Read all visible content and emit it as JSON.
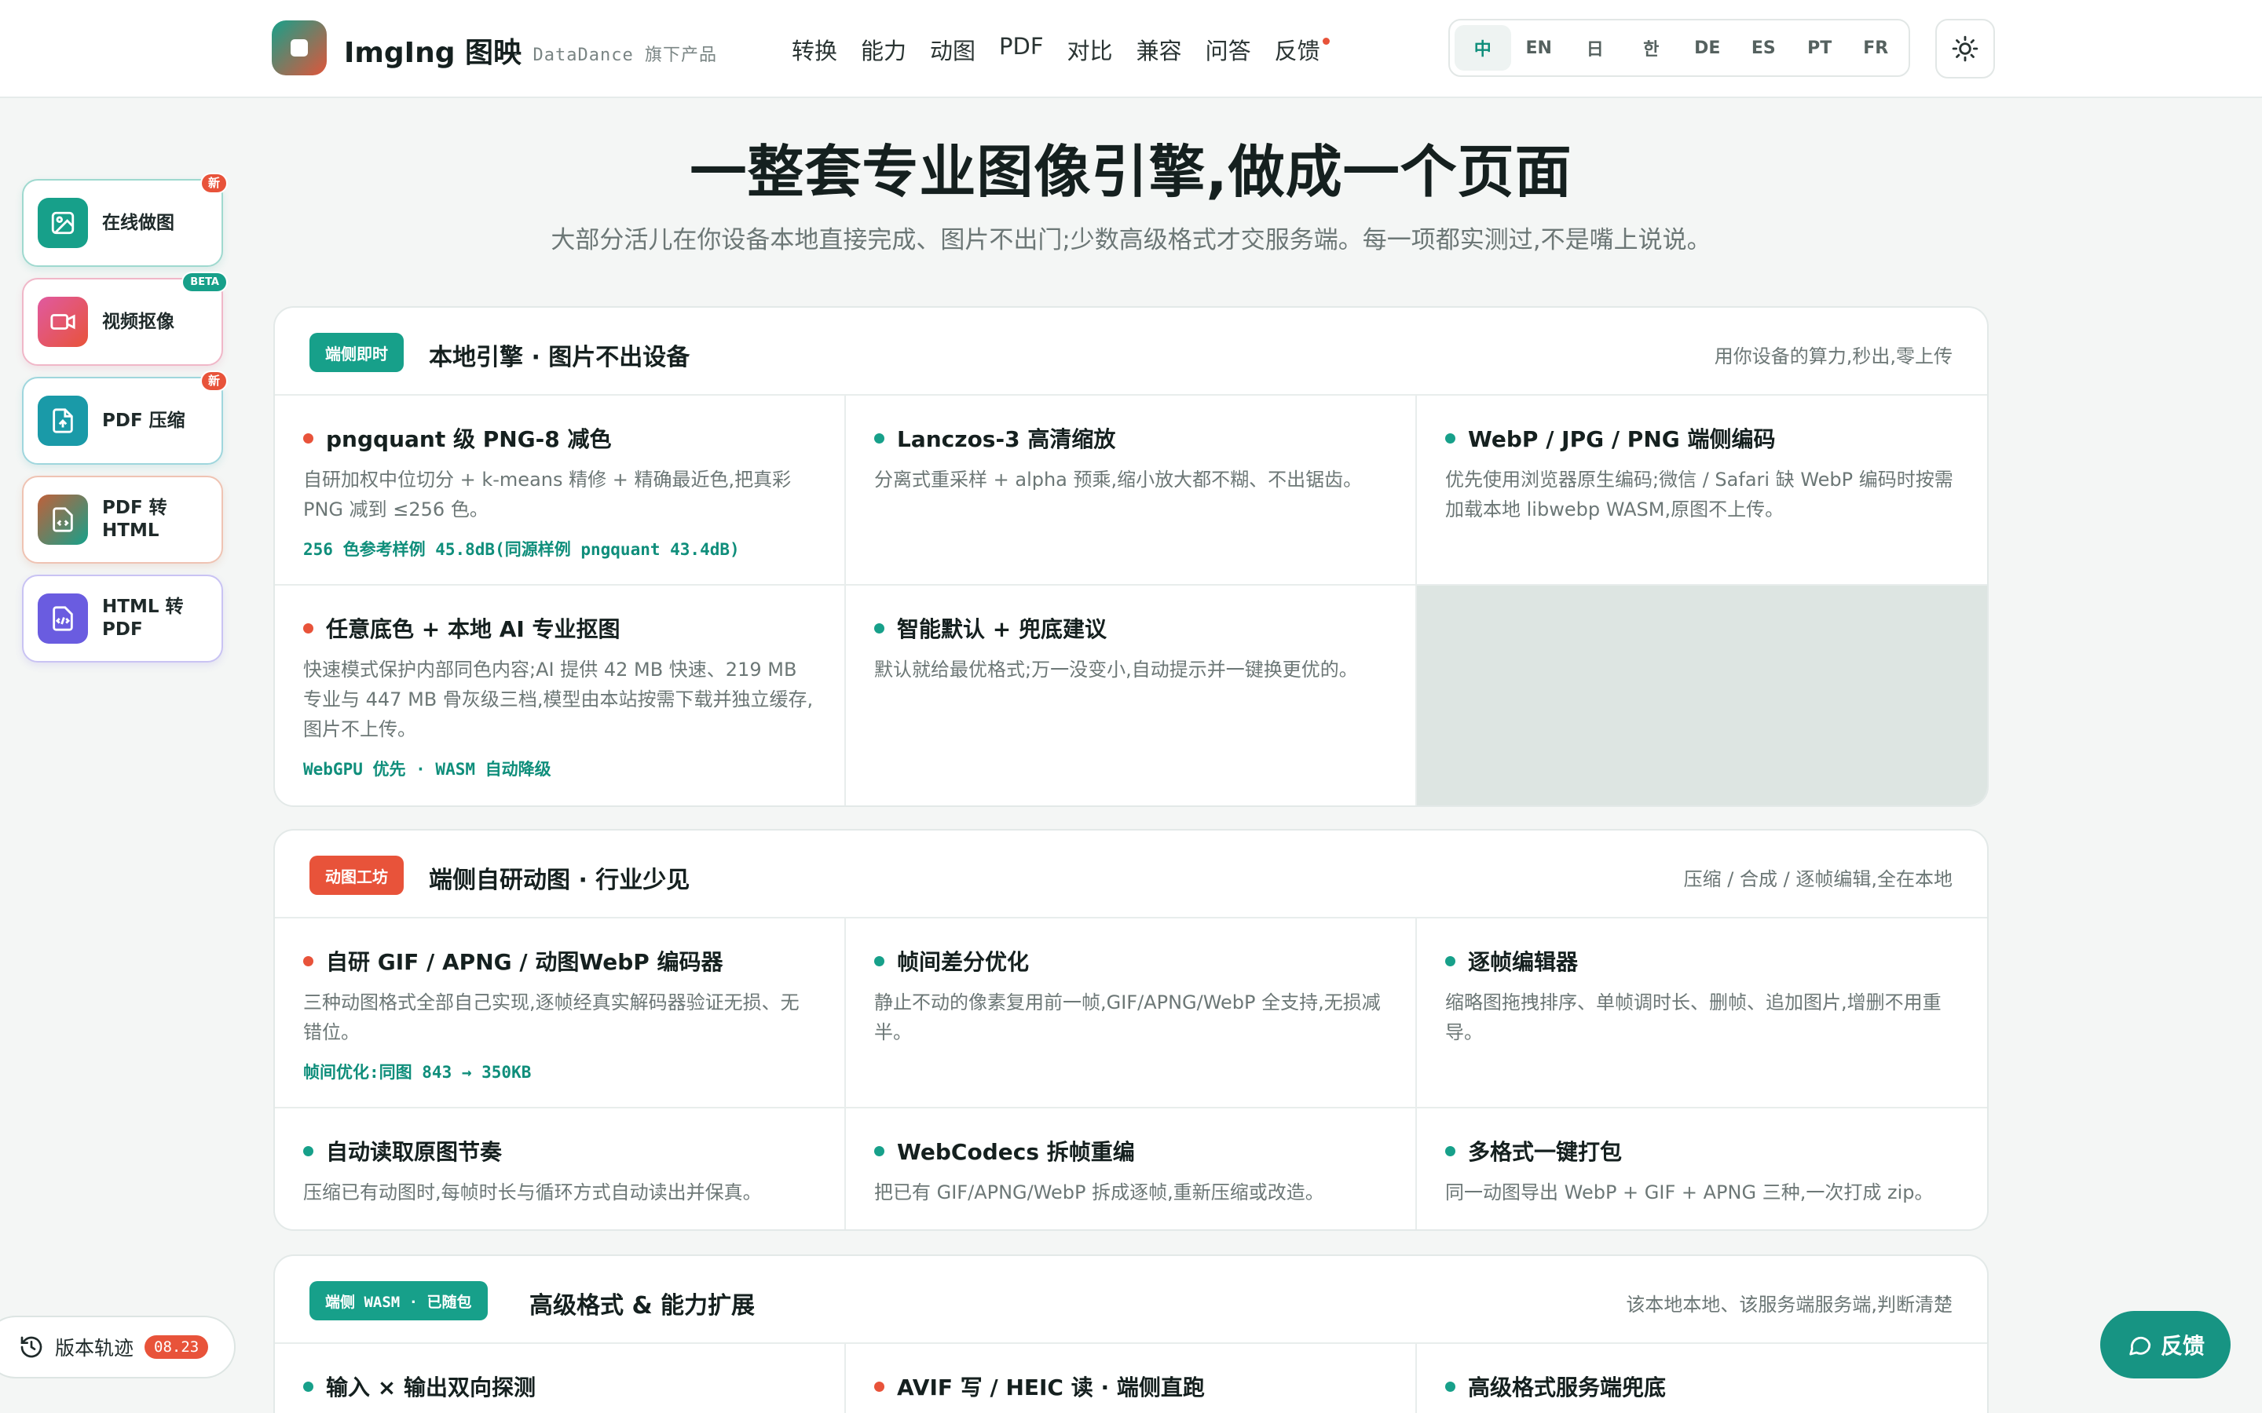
{
  "brand": {
    "name": "ImgIng 图映",
    "sub": "· DataDance 旗下产品"
  },
  "nav": {
    "items": [
      "转换",
      "能力",
      "动图",
      "PDF",
      "对比",
      "兼容",
      "问答",
      "反馈"
    ]
  },
  "languages": {
    "items": [
      "中",
      "EN",
      "日",
      "한",
      "DE",
      "ES",
      "PT",
      "FR"
    ],
    "active": "中"
  },
  "hero": {
    "title": "一整套专业图像引擎,做成一个页面",
    "subtitle": "大部分活儿在你设备本地直接完成、图片不出门;少数高级格式才交服务端。每一项都实测过,不是嘴上说说。"
  },
  "side_tools": [
    {
      "label": "在线做图",
      "badge": "新",
      "color": "#17a08a"
    },
    {
      "label": "视频抠像",
      "badge": "BETA",
      "color": "#d94f78"
    },
    {
      "label": "PDF 压缩",
      "badge": "新",
      "color": "#1a9aa8"
    },
    {
      "label": "PDF 转 HTML",
      "badge": "",
      "color": "#c0603a"
    },
    {
      "label": "HTML 转 PDF",
      "badge": "",
      "color": "#6a5ce0"
    }
  ],
  "version": {
    "label": "版本轨迹",
    "tag": "08.23"
  },
  "feedback": {
    "label": "反馈"
  },
  "sections": [
    {
      "tag": "端侧即时",
      "title": "本地引擎 · 图片不出设备",
      "note": "用你设备的算力,秒出,零上传",
      "cards": [
        {
          "title": "pngquant 级 PNG-8 减色",
          "desc": "自研加权中位切分 + k-means 精修 + 精确最近色,把真彩 PNG 减到 ≤256 色。",
          "meta": "256 色参考样例 45.8dB(同源样例 pngquant 43.4dB)",
          "dot": "red"
        },
        {
          "title": "Lanczos-3 高清缩放",
          "desc": "分离式重采样 + alpha 预乘,缩小放大都不糊、不出锯齿。",
          "meta": "",
          "dot": "teal"
        },
        {
          "title": "WebP / JPG / PNG 端侧编码",
          "desc": "优先使用浏览器原生编码;微信 / Safari 缺 WebP 编码时按需加载本地 libwebp WASM,原图不上传。",
          "meta": "",
          "dot": "teal"
        },
        {
          "title": "任意底色 + 本地 AI 专业抠图",
          "desc": "快速模式保护内部同色内容;AI 提供 42 MB 快速、219 MB 专业与 447 MB 骨灰级三档,模型由本站按需下载并独立缓存,图片不上传。",
          "meta": "WebGPU 优先 · WASM 自动降级",
          "dot": "red"
        },
        {
          "title": "智能默认 + 兜底建议",
          "desc": "默认就给最优格式;万一没变小,自动提示并一键换更优的。",
          "meta": "",
          "dot": "teal"
        }
      ]
    },
    {
      "tag": "动图工坊",
      "title": "端侧自研动图 · 行业少见",
      "note": "压缩 / 合成 / 逐帧编辑,全在本地",
      "cards": [
        {
          "title": "自研 GIF / APNG / 动图WebP 编码器",
          "desc": "三种动图格式全部自己实现,逐帧经真实解码器验证无损、无错位。",
          "meta": "帧间优化:同图 843 → 350KB",
          "dot": "red"
        },
        {
          "title": "帧间差分优化",
          "desc": "静止不动的像素复用前一帧,GIF/APNG/WebP 全支持,无损减半。",
          "meta": "",
          "dot": "teal"
        },
        {
          "title": "逐帧编辑器",
          "desc": "缩略图拖拽排序、单帧调时长、删帧、追加图片,增删不用重导。",
          "meta": "",
          "dot": "teal"
        },
        {
          "title": "自动读取原图节奏",
          "desc": "压缩已有动图时,每帧时长与循环方式自动读出并保真。",
          "meta": "",
          "dot": "teal"
        },
        {
          "title": "WebCodecs 拆帧重编",
          "desc": "把已有 GIF/APNG/WebP 拆成逐帧,重新压缩或改造。",
          "meta": "",
          "dot": "teal"
        },
        {
          "title": "多格式一键打包",
          "desc": "同一动图导出 WebP + GIF + APNG 三种,一次打成 zip。",
          "meta": "",
          "dot": "teal"
        }
      ]
    },
    {
      "tag": "端侧 WASM · 已随包",
      "title": "高级格式 & 能力扩展",
      "note": "该本地本地、该服务端服务端,判断清楚",
      "cards": [
        {
          "title": "输入 × 输出双向探测",
          "desc": "",
          "meta": "",
          "dot": "teal"
        },
        {
          "title": "AVIF 写 / HEIC 读 · 端侧直跑",
          "desc": "",
          "meta": "",
          "dot": "red"
        },
        {
          "title": "高级格式服务端兜底",
          "desc": "",
          "meta": "",
          "dot": "teal"
        }
      ]
    }
  ]
}
